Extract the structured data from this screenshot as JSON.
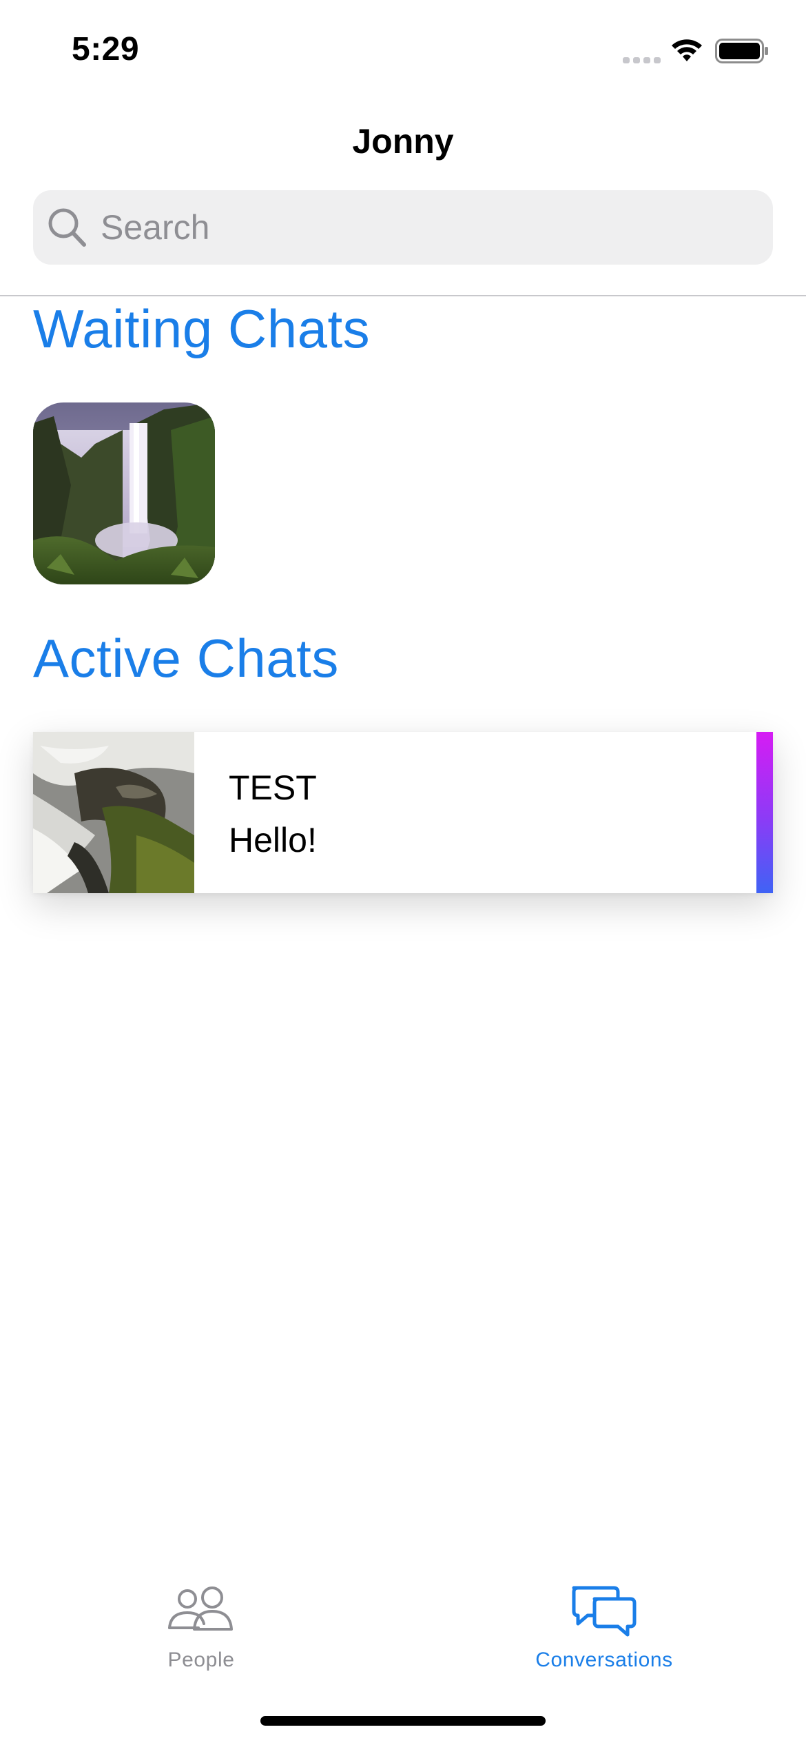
{
  "status_bar": {
    "time": "5:29",
    "icons": [
      "signal-icon",
      "wifi-icon",
      "battery-icon"
    ]
  },
  "nav": {
    "title": "Jonny"
  },
  "search": {
    "placeholder": "Search",
    "value": ""
  },
  "sections": {
    "waiting_title": "Waiting Chats",
    "active_title": "Active Chats"
  },
  "waiting_chats": [
    {
      "image": "waterfall-cliff-photo"
    }
  ],
  "active_chats": [
    {
      "image": "waterfall-rocks-photo",
      "name": "TEST",
      "last_message": "Hello!",
      "accent_colors": [
        "#d61cf4",
        "#3f63f5"
      ]
    }
  ],
  "tab_bar": {
    "tabs": [
      {
        "label": "People",
        "icon": "people-icon",
        "selected": false
      },
      {
        "label": "Conversations",
        "icon": "chat-bubbles-icon",
        "selected": true
      }
    ]
  },
  "colors": {
    "accent": "#1a7ee8",
    "inactive": "#8e8e93",
    "search_bg": "#efeff0"
  }
}
